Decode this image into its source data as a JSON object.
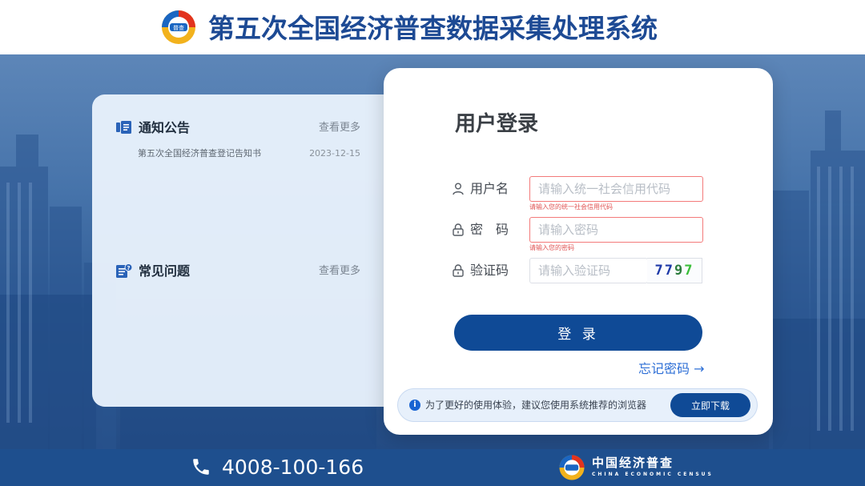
{
  "header": {
    "logo_icon": "census-logo-icon",
    "title": "第五次全国经济普查数据采集处理系统"
  },
  "notice_panel": {
    "announcements": {
      "icon": "announcement-icon",
      "title": "通知公告",
      "more": "查看更多",
      "items": [
        {
          "title": "第五次全国经济普查登记告知书",
          "date": "2023-12-15"
        }
      ]
    },
    "faq": {
      "icon": "faq-icon",
      "title": "常见问题",
      "more": "查看更多"
    }
  },
  "login": {
    "title": "用户登录",
    "username": {
      "icon": "user-icon",
      "label": "用户名",
      "placeholder": "请输入统一社会信用代码",
      "error": "请输入您的统一社会信用代码"
    },
    "password": {
      "icon": "lock-icon",
      "label": "密　码",
      "placeholder": "请输入密码",
      "error": "请输入您的密码"
    },
    "captcha": {
      "icon": "lock-icon",
      "label": "验证码",
      "placeholder": "请输入验证码",
      "code": [
        "7",
        "7",
        "9",
        "7"
      ]
    },
    "submit": "登 录",
    "forgot": "忘记密码 →",
    "browser_tip": {
      "icon": "info-icon",
      "text": "为了更好的使用体验，建议您使用系统推荐的浏览器",
      "button": "立即下载"
    }
  },
  "footer": {
    "phone_icon": "phone-icon",
    "phone": "4008-100-166",
    "brand_cn": "中国经济普查",
    "brand_en": "CHINA ECONOMIC CENSUS"
  },
  "colors": {
    "primary": "#0f4a96",
    "title": "#1d4a94",
    "error": "#e05454",
    "link": "#2e6fd6",
    "footer": "#1e4f8e"
  }
}
